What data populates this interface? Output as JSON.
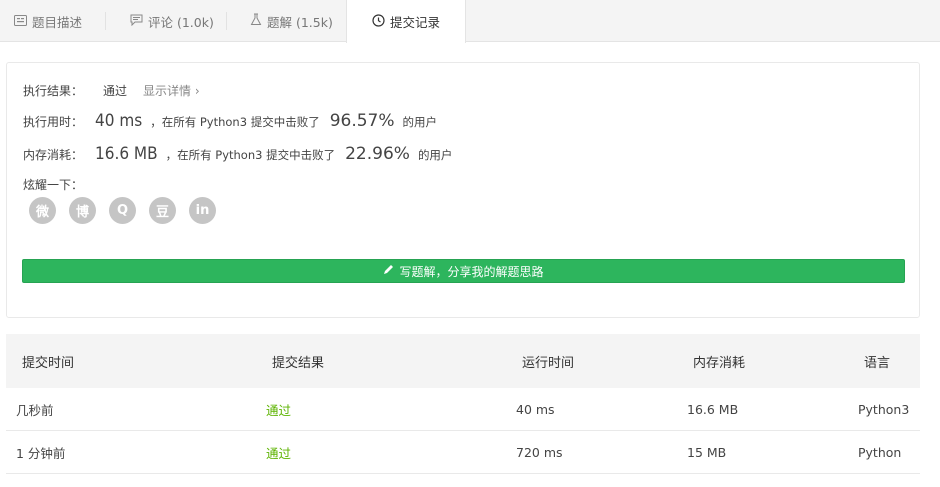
{
  "tabs": [
    {
      "label": "题目描述",
      "icon": "description-icon",
      "active": false
    },
    {
      "label": "评论 (1.0k)",
      "icon": "comment-icon",
      "active": false
    },
    {
      "label": "题解 (1.5k)",
      "icon": "flask-icon",
      "active": false
    },
    {
      "label": "提交记录",
      "icon": "clock-icon",
      "active": true
    }
  ],
  "result": {
    "status_label": "执行结果：",
    "status_value": "通过",
    "detail_link": "显示详情 ›",
    "runtime_label": "执行用时：",
    "runtime_value": "40 ms",
    "runtime_text": "，在所有 Python3 提交中击败了",
    "runtime_percent": "96.57%",
    "runtime_suffix": "的用户",
    "memory_label": "内存消耗：",
    "memory_value": "16.6 MB",
    "memory_text": "，在所有 Python3 提交中击败了",
    "memory_percent": "22.96%",
    "memory_suffix": "的用户",
    "share_label": "炫耀一下：",
    "share_icons": [
      "wechat-icon",
      "weibo-icon",
      "qq-icon",
      "douban-icon",
      "linkedin-icon"
    ],
    "share_glyphs": [
      "微",
      "博",
      "Q",
      "豆",
      "in"
    ],
    "solution_button": "写题解，分享我的解题思路"
  },
  "table": {
    "headers": [
      "提交时间",
      "提交结果",
      "运行时间",
      "内存消耗",
      "语言"
    ],
    "rows": [
      [
        "几秒前",
        "通过",
        "40 ms",
        "16.6 MB",
        "Python3"
      ],
      [
        "1 分钟前",
        "通过",
        "720 ms",
        "15 MB",
        "Python"
      ]
    ]
  },
  "colors": {
    "accent_green": "#2db55d",
    "pass_green": "#5cb300"
  }
}
